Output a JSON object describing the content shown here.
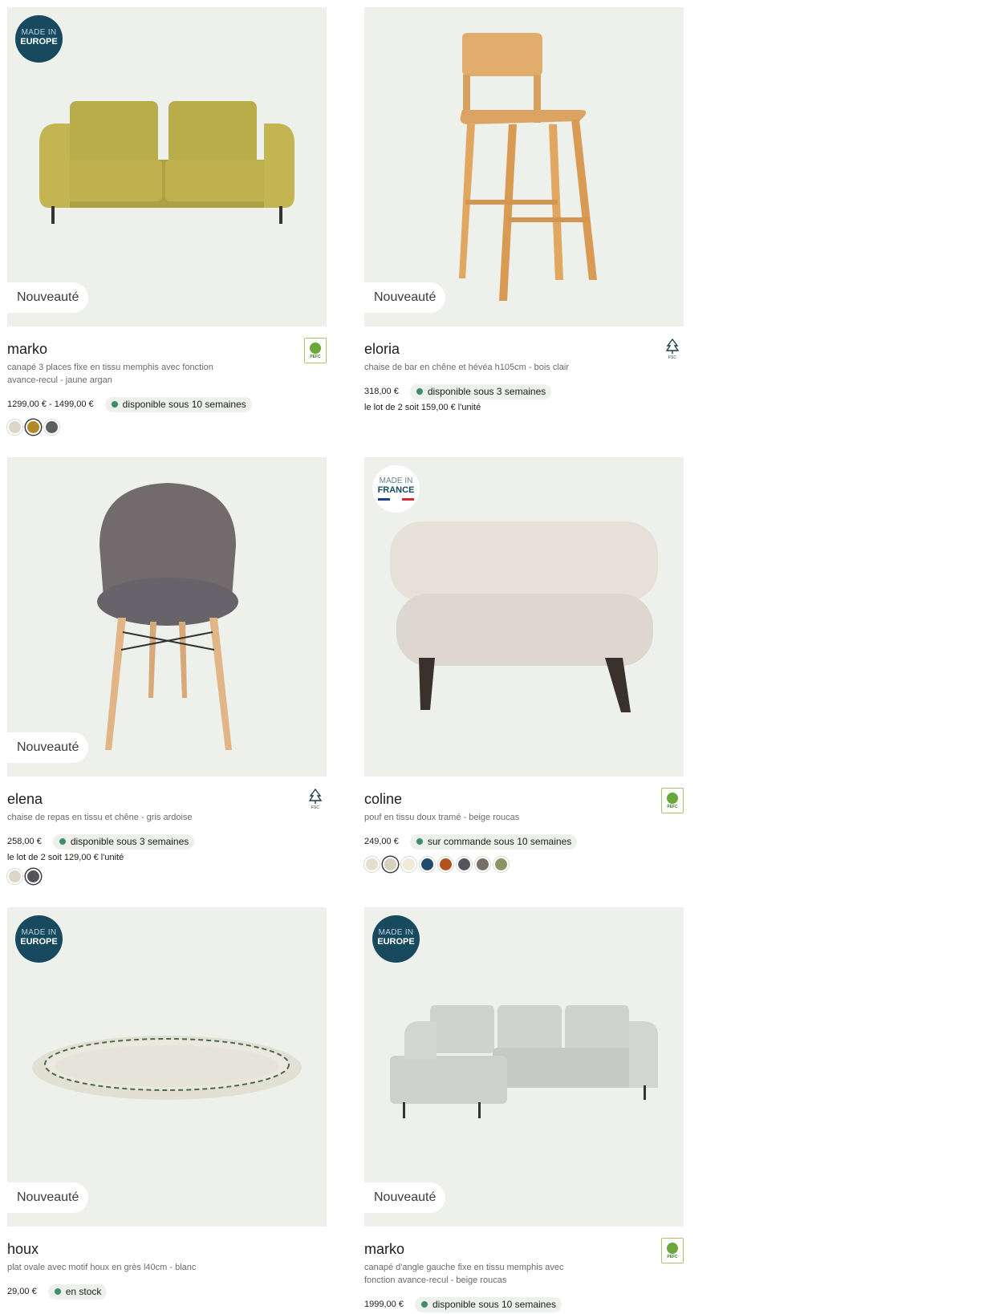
{
  "products": [
    {
      "name": "marko",
      "description": "canapé 3 places fixe en tissu memphis avec fonction avance-recul - jaune argan",
      "price": "1299,00 € - 1499,00 €",
      "availability": "disponible sous 10 semaines",
      "new_label": "Nouveauté",
      "badge": {
        "line1": "MADE IN",
        "line2": "EUROPE"
      },
      "cert": "PEFC",
      "swatches": [
        "#ddd6c7",
        "#b08a2a",
        "#5c605a"
      ],
      "selected_swatch": 1
    },
    {
      "name": "eloria",
      "description": "chaise de bar en chêne et hévéa h105cm - bois clair",
      "price": "318,00 €",
      "availability": "disponible sous 3 semaines",
      "lot": "le lot de 2 soit 159,00 € l'unité",
      "new_label": "Nouveauté",
      "cert": "FSC"
    },
    {
      "name": "elena",
      "description": "chaise de repas en tissu et chêne - gris ardoise",
      "price": "258,00 €",
      "availability": "disponible sous 3 semaines",
      "lot": "le lot de 2 soit 129,00 € l'unité",
      "new_label": "Nouveauté",
      "cert": "FSC",
      "swatches": [
        "#ddd6c7",
        "#545558"
      ],
      "selected_swatch": 1
    },
    {
      "name": "coline",
      "description": "pouf en tissu doux tramé - beige roucas",
      "price": "249,00 €",
      "availability": "sur commande sous 10 semaines",
      "badge": {
        "line1": "MADE IN",
        "line2": "FRANCE"
      },
      "cert": "PEFC",
      "swatches": [
        "#e6ddcf",
        "#d8cfbe",
        "#f2e8d8",
        "#214a6c",
        "#b4531d",
        "#55565c",
        "#7a6f66",
        "#8d9363"
      ],
      "selected_swatch": 1
    },
    {
      "name": "houx",
      "description": "plat ovale avec motif houx en grès l40cm - blanc",
      "price": "29,00 €",
      "availability": "en stock",
      "new_label": "Nouveauté",
      "badge": {
        "line1": "MADE IN",
        "line2": "EUROPE"
      }
    },
    {
      "name": "marko",
      "description": "canapé d'angle gauche fixe en tissu memphis avec fonction avance-recul - beige roucas",
      "price": "1999,00 €",
      "availability": "disponible sous 10 semaines",
      "new_label": "Nouveauté",
      "badge": {
        "line1": "MADE IN",
        "line2": "EUROPE"
      },
      "cert": "PEFC"
    }
  ],
  "colors": {
    "image_bg": "#eef0ec",
    "badge_blue": "#184a5f",
    "availability_dot": "#3d8f6c"
  },
  "icons": {
    "pefc": "pefc-logo-icon",
    "fsc": "fsc-tree-icon"
  }
}
